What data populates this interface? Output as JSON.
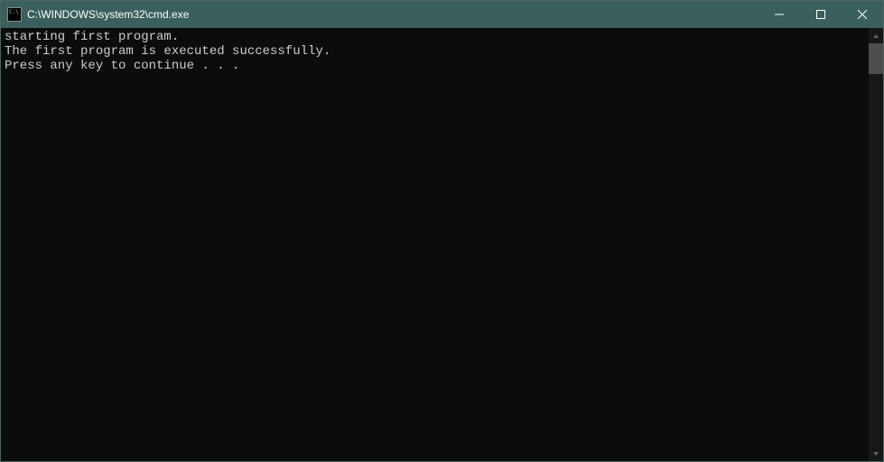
{
  "window": {
    "title": "C:\\WINDOWS\\system32\\cmd.exe"
  },
  "terminal": {
    "lines": [
      "starting first program.",
      "The first program is executed successfully.",
      "Press any key to continue . . ."
    ]
  }
}
